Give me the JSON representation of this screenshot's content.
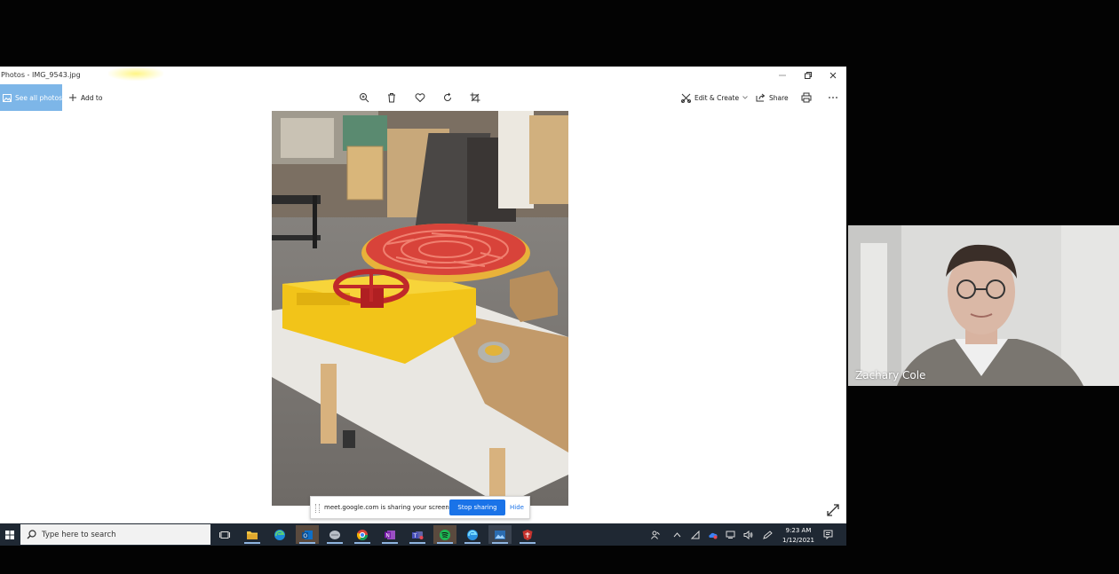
{
  "window": {
    "title": "Photos - IMG_9543.jpg"
  },
  "toolbar": {
    "see_all_photos": "See all photos",
    "add_to": "Add to",
    "edit_create": "Edit & Create",
    "share": "Share"
  },
  "share_bar": {
    "message": "meet.google.com is sharing your screen.",
    "stop_label": "Stop sharing",
    "hide_label": "Hide"
  },
  "taskbar": {
    "search_placeholder": "Type here to search",
    "time": "9:23 AM",
    "date": "1/12/2021"
  },
  "participant": {
    "name": "Zachary Cole"
  },
  "colors": {
    "accent": "#7db6e8",
    "meet_blue": "#1a73e8",
    "taskbar": "#1f2833"
  }
}
